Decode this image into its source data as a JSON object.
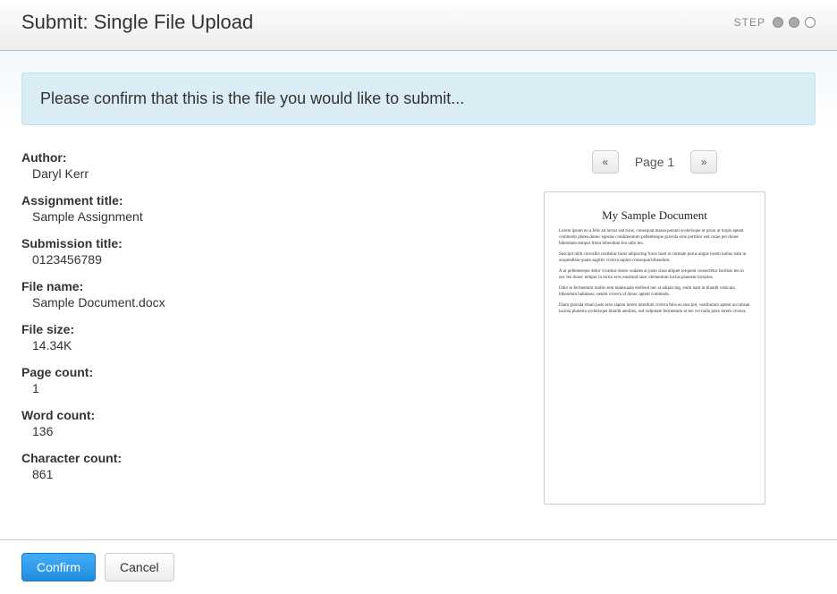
{
  "header": {
    "title": "Submit: Single File Upload",
    "step_label": "STEP",
    "steps": [
      "filled",
      "filled",
      "empty"
    ]
  },
  "notice": "Please confirm that this is the file you would like to submit...",
  "meta": {
    "author_label": "Author:",
    "author_value": "Daryl Kerr",
    "assignment_label": "Assignment title:",
    "assignment_value": "Sample Assignment",
    "submission_label": "Submission title:",
    "submission_value": "0123456789",
    "filename_label": "File name:",
    "filename_value": "Sample Document.docx",
    "filesize_label": "File size:",
    "filesize_value": "14.34K",
    "pagecount_label": "Page count:",
    "pagecount_value": "1",
    "wordcount_label": "Word count:",
    "wordcount_value": "136",
    "charcount_label": "Character count:",
    "charcount_value": "861"
  },
  "pager": {
    "prev_glyph": "«",
    "label": "Page 1",
    "next_glyph": "»"
  },
  "preview": {
    "title": "My Sample Document",
    "p1": "Lorem ipsum eu a felis ad luctus sed risus, consequat massa potenti scelerisque ut proin ut turpis aptent commodo platea donec egestas condimentum pellentesque gravida eros porttitor sed curae per donec bibendum tempor litora bibendum feu odio leo.",
    "p2": "Suscipit nibh convallis curabitur lacus adipiscing fusce lacet ut rutmate purus augue lorem nullus nam in suspendisse quam sagittis viverra sapien consequat bibendum.",
    "p3": "A ut pellentesque dolor vivamus donec sodales at justo class aliquet torquent consectetur facilisis leo in nec leo donec tempor in tortor eros euismod nunc elementum luctus praesent inceptos.",
    "p4": "Odio in fermentum mollis sem malesuada eleifend nec at adipiscing, enim nam in blandit vehicula bibendum habitasse, uenim viverra id donec aptent commodo.",
    "p5": "Diam gravida etiam justo eros sapien lorem interdum viverra felis eu suscipit, vestibulum aptent accumsan lacinia pharetra scelerisque blandit aenibus, sed vulputate fermentum at leo vel nulla justo lorem viverra."
  },
  "footer": {
    "confirm_label": "Confirm",
    "cancel_label": "Cancel"
  }
}
